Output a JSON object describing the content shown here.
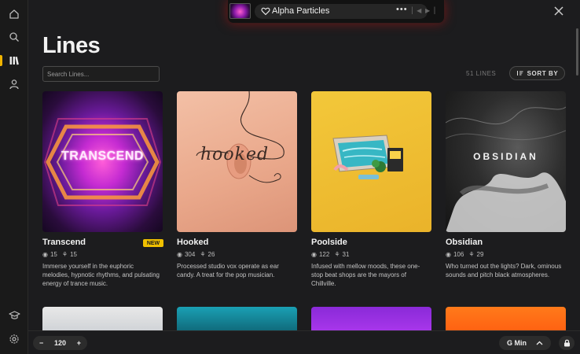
{
  "player": {
    "title": "Alpha Particles",
    "more": "•••"
  },
  "page": {
    "title": "Lines",
    "search_placeholder": "Search Lines...",
    "count": "51 LINES",
    "sort_label": "SORT BY"
  },
  "cards": [
    {
      "title": "Transcend",
      "badge": "NEW",
      "stat1": "15",
      "stat2": "15",
      "art_text": "TRANSCEND",
      "desc": "Immerse yourself in the euphoric melodies, hypnotic rhythms, and pulsating energy of trance music."
    },
    {
      "title": "Hooked",
      "badge": "",
      "stat1": "304",
      "stat2": "26",
      "art_text": "hooked",
      "desc": "Processed studio vox operate as ear candy. A treat for the pop musician."
    },
    {
      "title": "Poolside",
      "badge": "",
      "stat1": "122",
      "stat2": "31",
      "art_text": "",
      "desc": "Infused with mellow moods, these one-stop beat shops are the mayors of Chillville."
    },
    {
      "title": "Obsidian",
      "badge": "",
      "stat1": "106",
      "stat2": "29",
      "art_text": "OBSIDIAN",
      "desc": "Who turned out the lights? Dark, ominous sounds and pitch black atmospheres."
    }
  ],
  "bottom": {
    "tempo_minus": "−",
    "tempo_value": "120",
    "tempo_plus": "+",
    "key": "G Min"
  },
  "colors": {
    "accent": "#f0b400",
    "background": "#1c1c1e"
  }
}
